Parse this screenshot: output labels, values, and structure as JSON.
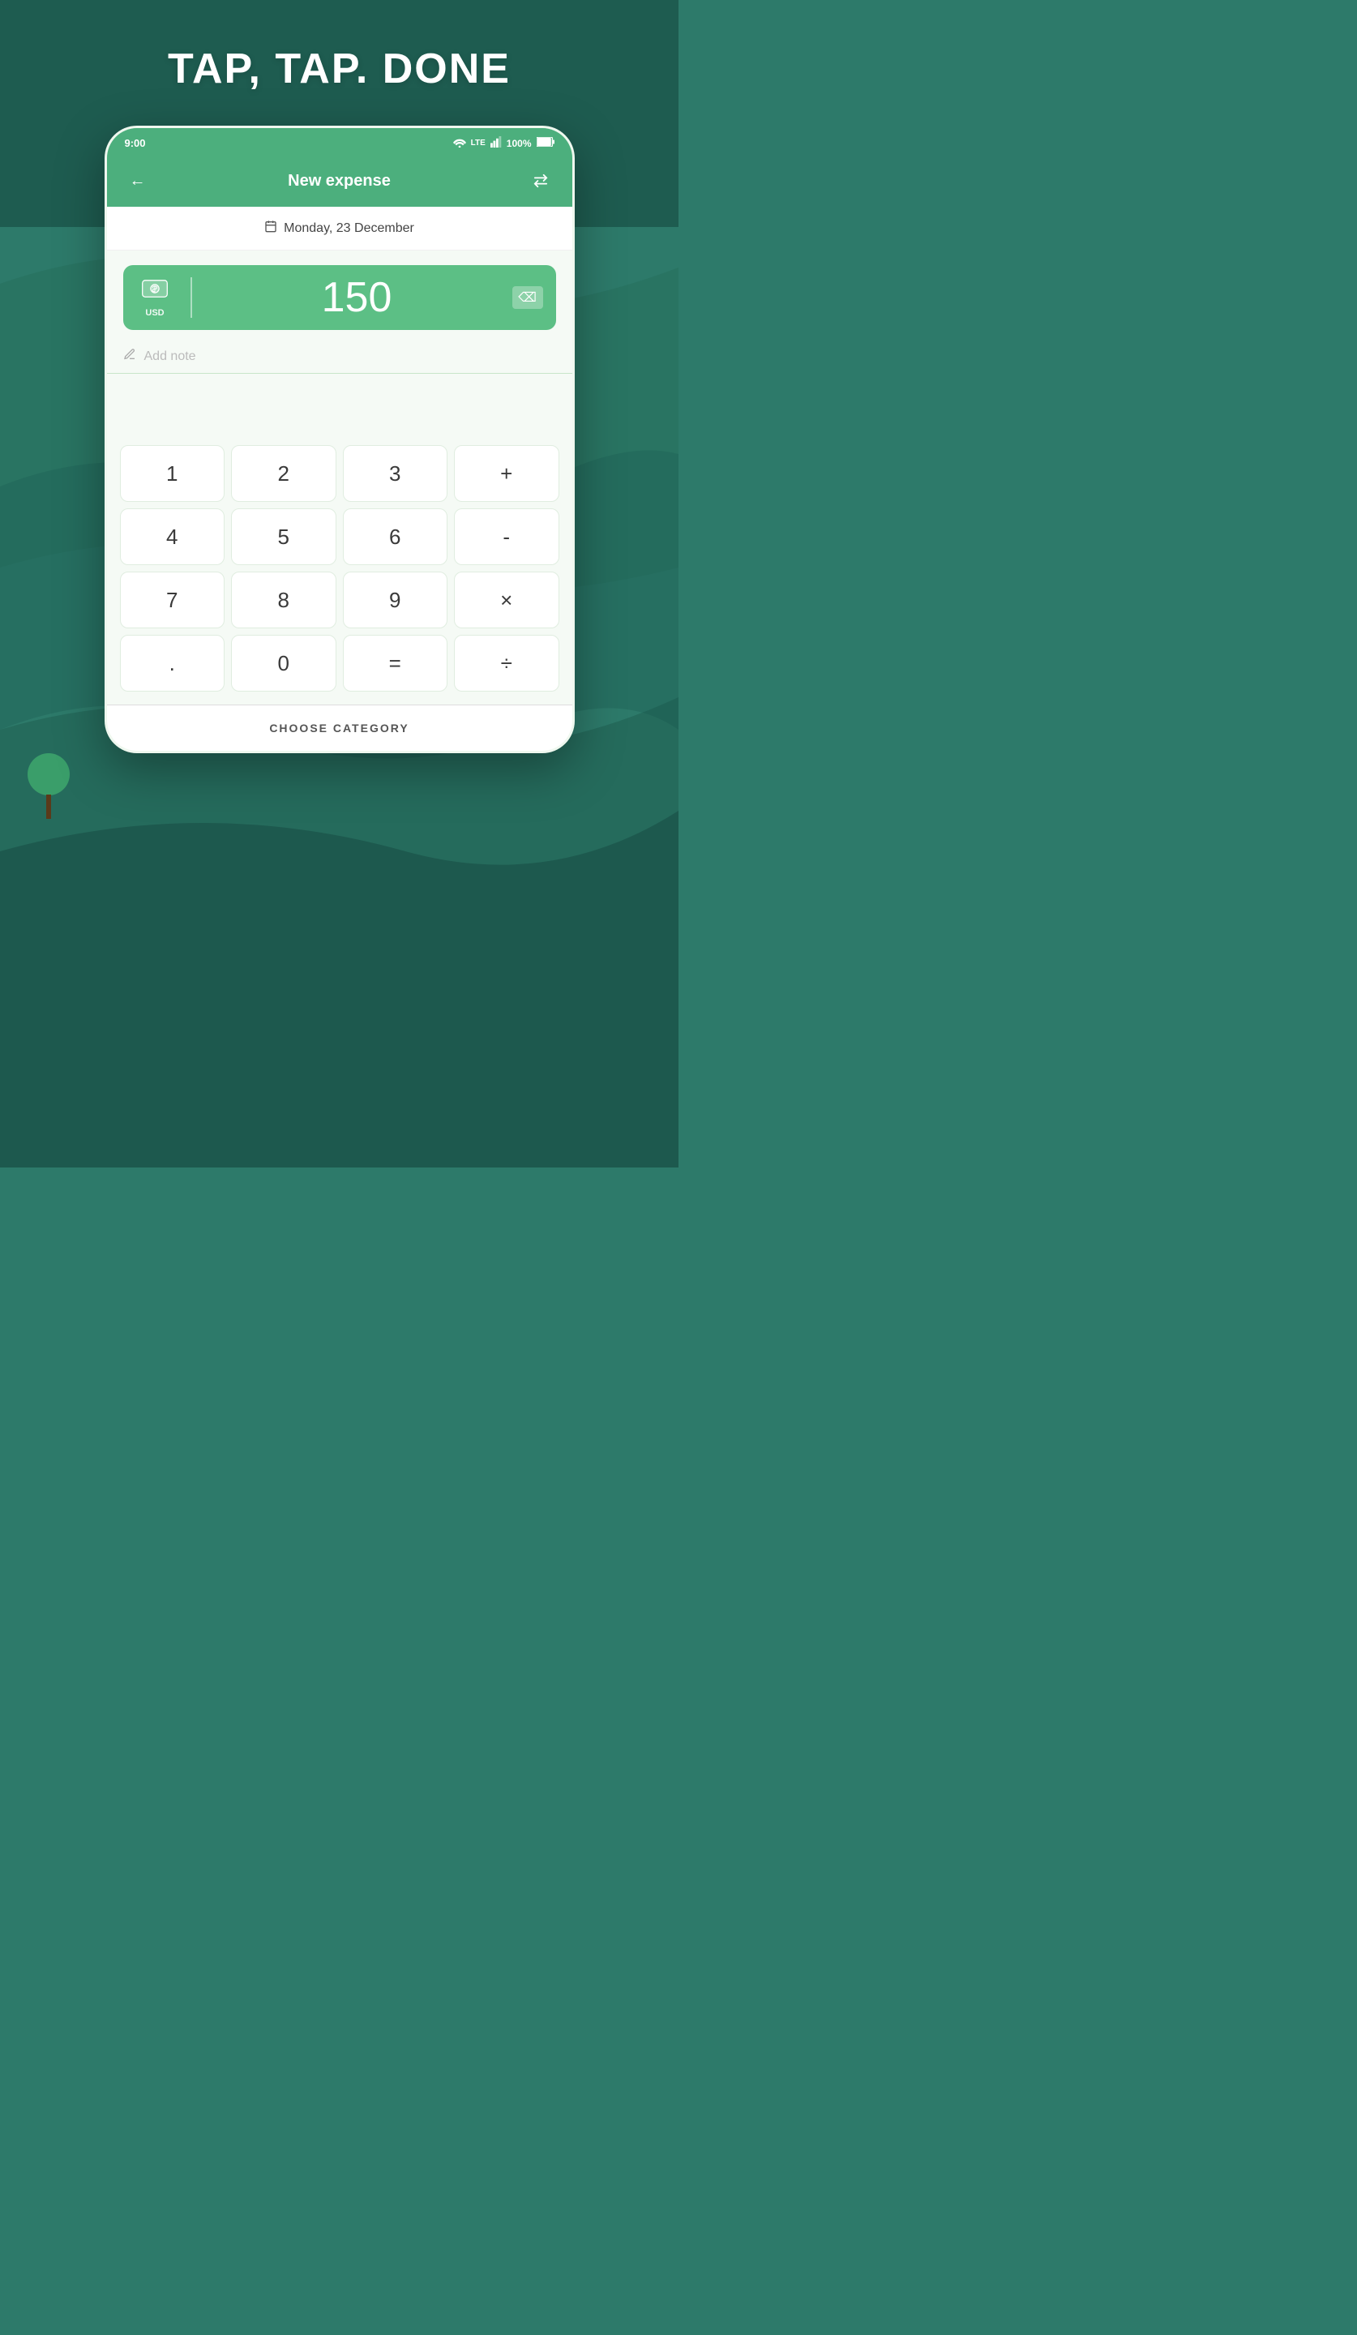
{
  "background": {
    "color": "#2d7a6a"
  },
  "headline": "TAP, TAP. DONE",
  "status_bar": {
    "time": "9:00",
    "battery": "100%",
    "signal": "LTE"
  },
  "app_bar": {
    "title": "New expense",
    "back_icon": "←",
    "swap_icon": "⇄"
  },
  "date": {
    "label": "Monday, 23 December",
    "calendar_symbol": "📅"
  },
  "amount": {
    "value": "150",
    "currency": "USD",
    "backspace_symbol": "⌫"
  },
  "note": {
    "placeholder": "Add note"
  },
  "calculator": {
    "rows": [
      [
        "1",
        "2",
        "3",
        "+"
      ],
      [
        "4",
        "5",
        "6",
        "-"
      ],
      [
        "7",
        "8",
        "9",
        "×"
      ],
      [
        ".",
        "0",
        "=",
        "÷"
      ]
    ]
  },
  "choose_category": {
    "label": "CHOOSE CATEGORY"
  }
}
